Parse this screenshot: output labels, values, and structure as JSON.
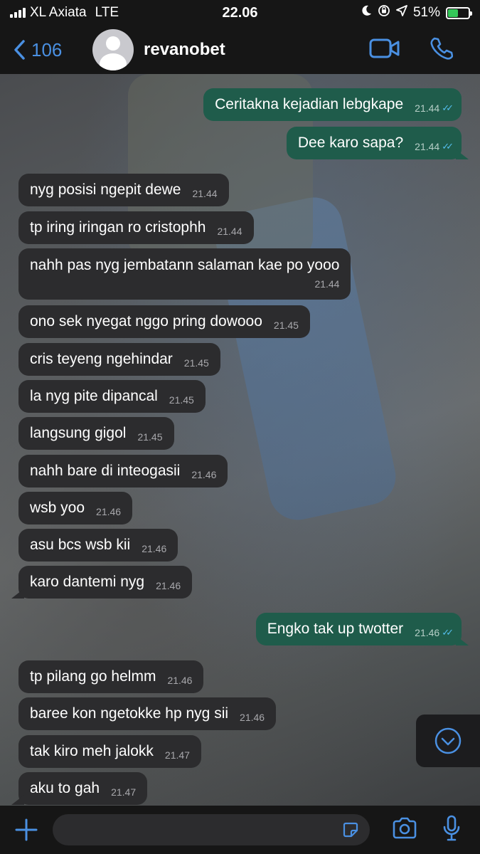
{
  "status": {
    "carrier": "XL Axiata",
    "network": "LTE",
    "time": "22.06",
    "battery": "51%",
    "battery_level": 0.51
  },
  "header": {
    "back_count": "106",
    "contact_name": "revanobet"
  },
  "messages": [
    {
      "dir": "out",
      "text": "Ceritakna kejadian lebgkape",
      "time": "21.44",
      "tail": false
    },
    {
      "dir": "out",
      "text": "Dee karo sapa?",
      "time": "21.44",
      "tail": true
    },
    {
      "dir": "in",
      "text": "nyg posisi ngepit dewe",
      "time": "21.44"
    },
    {
      "dir": "in",
      "text": "tp iring iringan ro cristophh",
      "time": "21.44"
    },
    {
      "dir": "in",
      "text": "nahh pas nyg jembatann salaman kae po yooo",
      "time": "21.44"
    },
    {
      "dir": "in",
      "text": "ono sek nyegat nggo pring dowooo",
      "time": "21.45"
    },
    {
      "dir": "in",
      "text": "cris teyeng ngehindar",
      "time": "21.45"
    },
    {
      "dir": "in",
      "text": "la nyg pite dipancal",
      "time": "21.45"
    },
    {
      "dir": "in",
      "text": "langsung gigol",
      "time": "21.45"
    },
    {
      "dir": "in",
      "text": "nahh bare di inteogasii",
      "time": "21.46"
    },
    {
      "dir": "in",
      "text": "wsb yoo",
      "time": "21.46"
    },
    {
      "dir": "in",
      "text": "asu bcs wsb kii",
      "time": "21.46"
    },
    {
      "dir": "in",
      "text": "karo dantemi nyg",
      "time": "21.46"
    },
    {
      "dir": "out",
      "text": "Engko tak up twotter",
      "time": "21.46"
    },
    {
      "dir": "in",
      "text": "tp pilang go helmm",
      "time": "21.46"
    },
    {
      "dir": "in",
      "text": "baree kon ngetokke hp nyg sii",
      "time": "21.46"
    },
    {
      "dir": "in",
      "text": "tak kiro meh jalokk",
      "time": "21.47"
    },
    {
      "dir": "in",
      "text": "aku to gah",
      "time": "21.47"
    }
  ],
  "input": {
    "placeholder": ""
  },
  "colors": {
    "accent": "#4a90e2",
    "outgoing": "#1f5c4b",
    "incoming": "#2c2c2e",
    "read_ticks": "#53bdeb"
  }
}
